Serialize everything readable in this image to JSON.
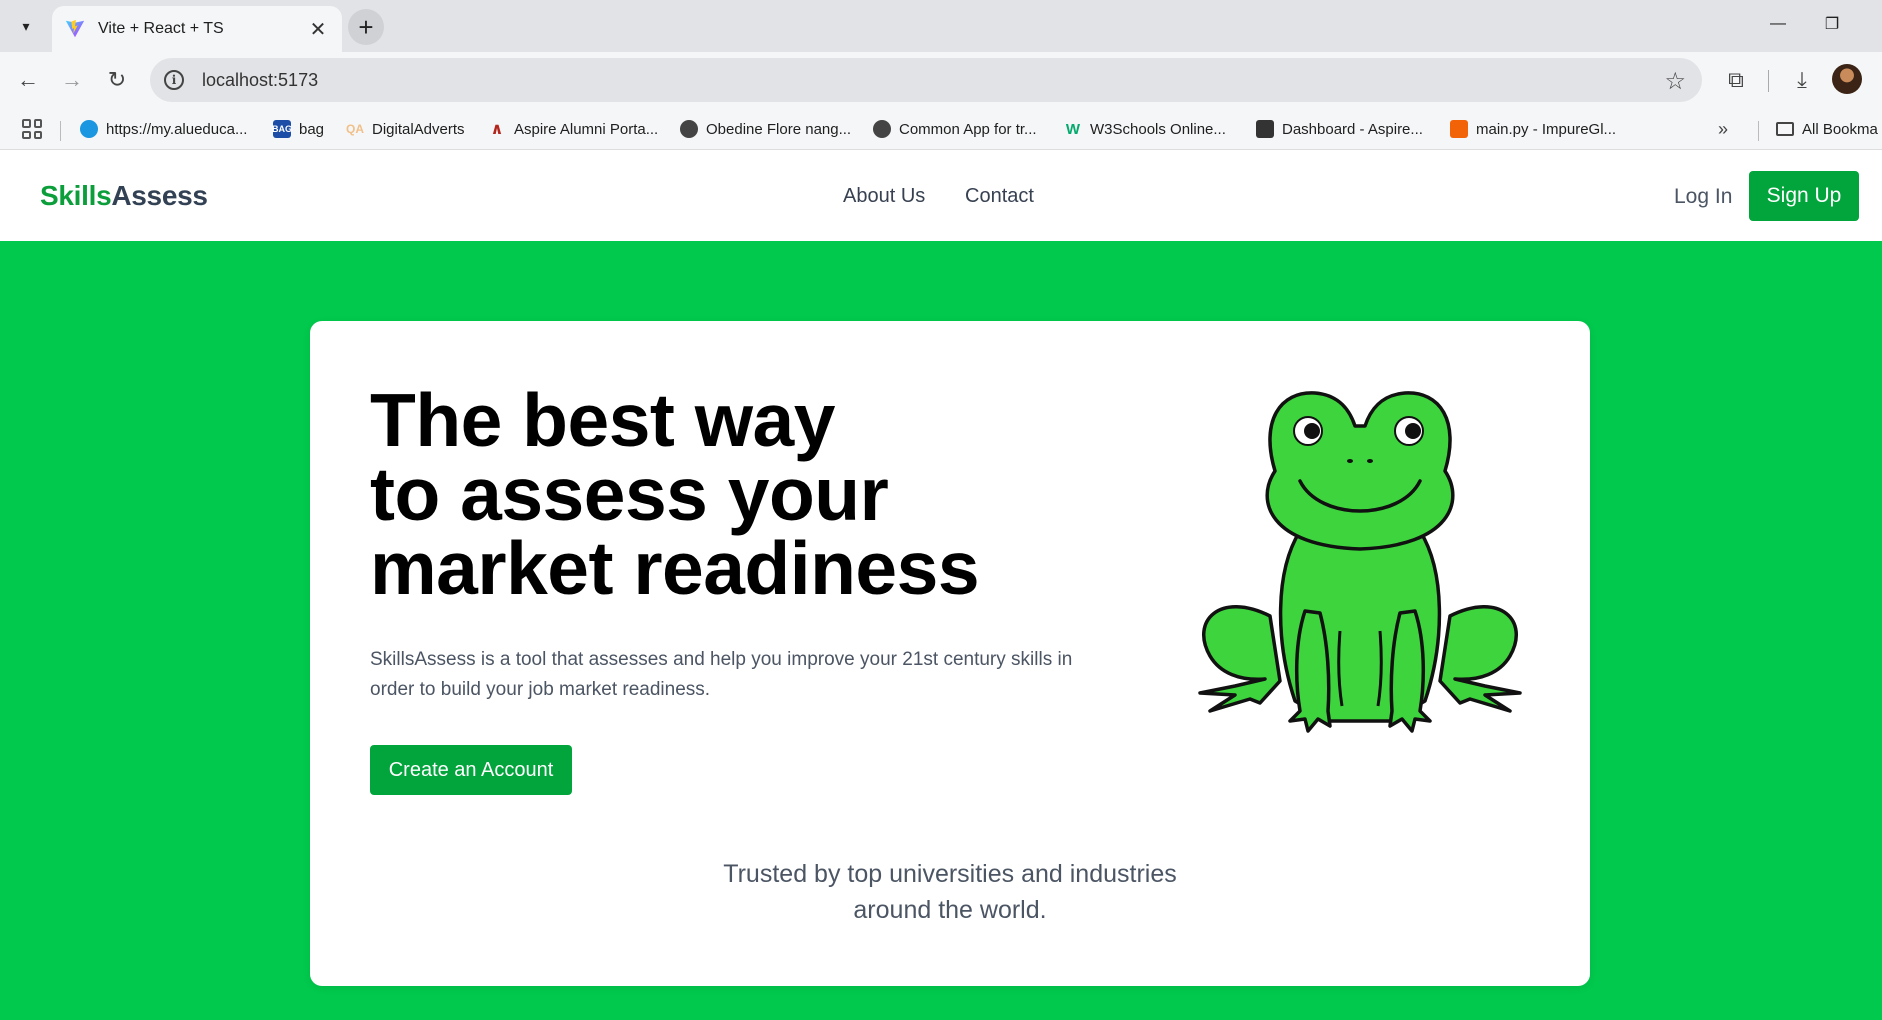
{
  "browser": {
    "tab_title": "Vite + React + TS",
    "url": "localhost:5173",
    "bookmarks": [
      {
        "label": "https://my.alueduca...",
        "icon": "salesforce-cloud-icon",
        "color": "#1b96e0"
      },
      {
        "label": "bag",
        "icon": "bag-icon",
        "color": "#1c4ea8"
      },
      {
        "label": "DigitalAdverts",
        "icon": "qa-icon",
        "color": "#f1c08a"
      },
      {
        "label": "Aspire Alumni Porta...",
        "icon": "aspire-icon",
        "color": "#b3261e"
      },
      {
        "label": "Obedine Flore nang...",
        "icon": "globe-icon",
        "color": "#444444"
      },
      {
        "label": "Common App for tr...",
        "icon": "globe-icon",
        "color": "#444444"
      },
      {
        "label": "W3Schools Online...",
        "icon": "w3schools-icon",
        "color": "#04aa6d"
      },
      {
        "label": "Dashboard - Aspire...",
        "icon": "dashboard-icon",
        "color": "#333333"
      },
      {
        "label": "main.py - ImpureGl...",
        "icon": "replit-icon",
        "color": "#f26207"
      }
    ],
    "all_bookmarks_label": "All Bookma"
  },
  "site": {
    "logo_part1": "Skills",
    "logo_part2": "Assess",
    "nav": [
      "About Us",
      "Contact"
    ],
    "login_label": "Log In",
    "signup_label": "Sign Up"
  },
  "hero": {
    "headline_lines": [
      "The best way",
      "to assess your",
      "market readiness"
    ],
    "description": "SkillsAssess is a tool that assesses and help you improve your 21st century skills in order to build your job market readiness.",
    "cta_label": "Create an Account",
    "trusted_line1": "Trusted by top universities and industries",
    "trusted_line2": "around the world."
  },
  "colors": {
    "brand_green": "#02a43c",
    "background_green": "#00c94d",
    "frog_green": "#3dd43d"
  }
}
